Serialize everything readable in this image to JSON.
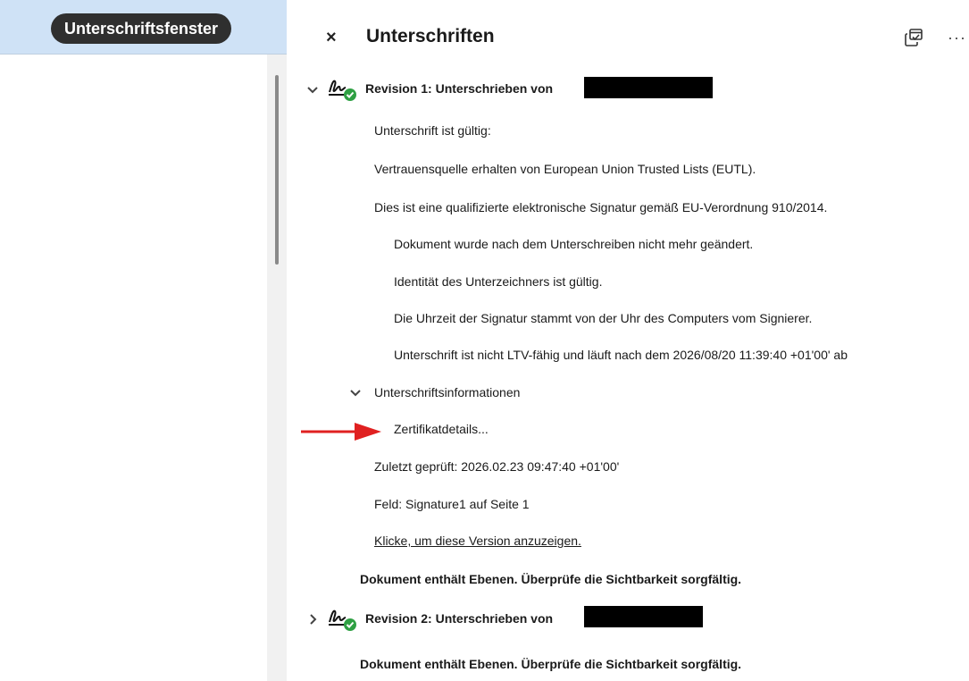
{
  "left_panel": {
    "tooltip": "Unterschriftsfenster"
  },
  "panel": {
    "close_glyph": "×",
    "title": "Unterschriften",
    "popout_icon": "open-in-new-window-icon",
    "more_glyph": "···"
  },
  "revisions": [
    {
      "title": "Revision 1: Unterschrieben von",
      "expanded": true,
      "details": [
        "Unterschrift ist gültig:",
        "Vertrauensquelle erhalten von European Union Trusted Lists (EUTL).",
        "Dies ist eine qualifizierte elektronische Signatur gemäß EU-Verordnung 910/2014."
      ],
      "sub_details": [
        "Dokument wurde nach dem Unterschreiben nicht mehr geändert.",
        "Identität des Unterzeichners ist gültig.",
        "Die Uhrzeit der Signatur stammt von der Uhr des Computers vom Signierer.",
        "Unterschrift ist nicht LTV-fähig und läuft nach dem 2026/08/20 11:39:40 +01'00' ab"
      ],
      "info_section": {
        "label": "Unterschriftsinformationen",
        "certificate_link": "Zertifikatdetails..."
      },
      "last_checked": "Zuletzt geprüft: 2026.02.23 09:47:40 +01'00'",
      "field": "Feld: Signature1 auf Seite 1",
      "view_version_link": "Klicke, um diese Version anzuzeigen.",
      "warning": "Dokument enthält Ebenen. Überprüfe die Sichtbarkeit sorgfältig."
    },
    {
      "title": "Revision 2: Unterschrieben von",
      "expanded": false,
      "warning": "Dokument enthält Ebenen. Überprüfe die Sichtbarkeit sorgfältig."
    }
  ],
  "colors": {
    "header_bg": "#cfe2f6",
    "valid_badge": "#2ea043",
    "annotation_arrow": "#e02020"
  }
}
